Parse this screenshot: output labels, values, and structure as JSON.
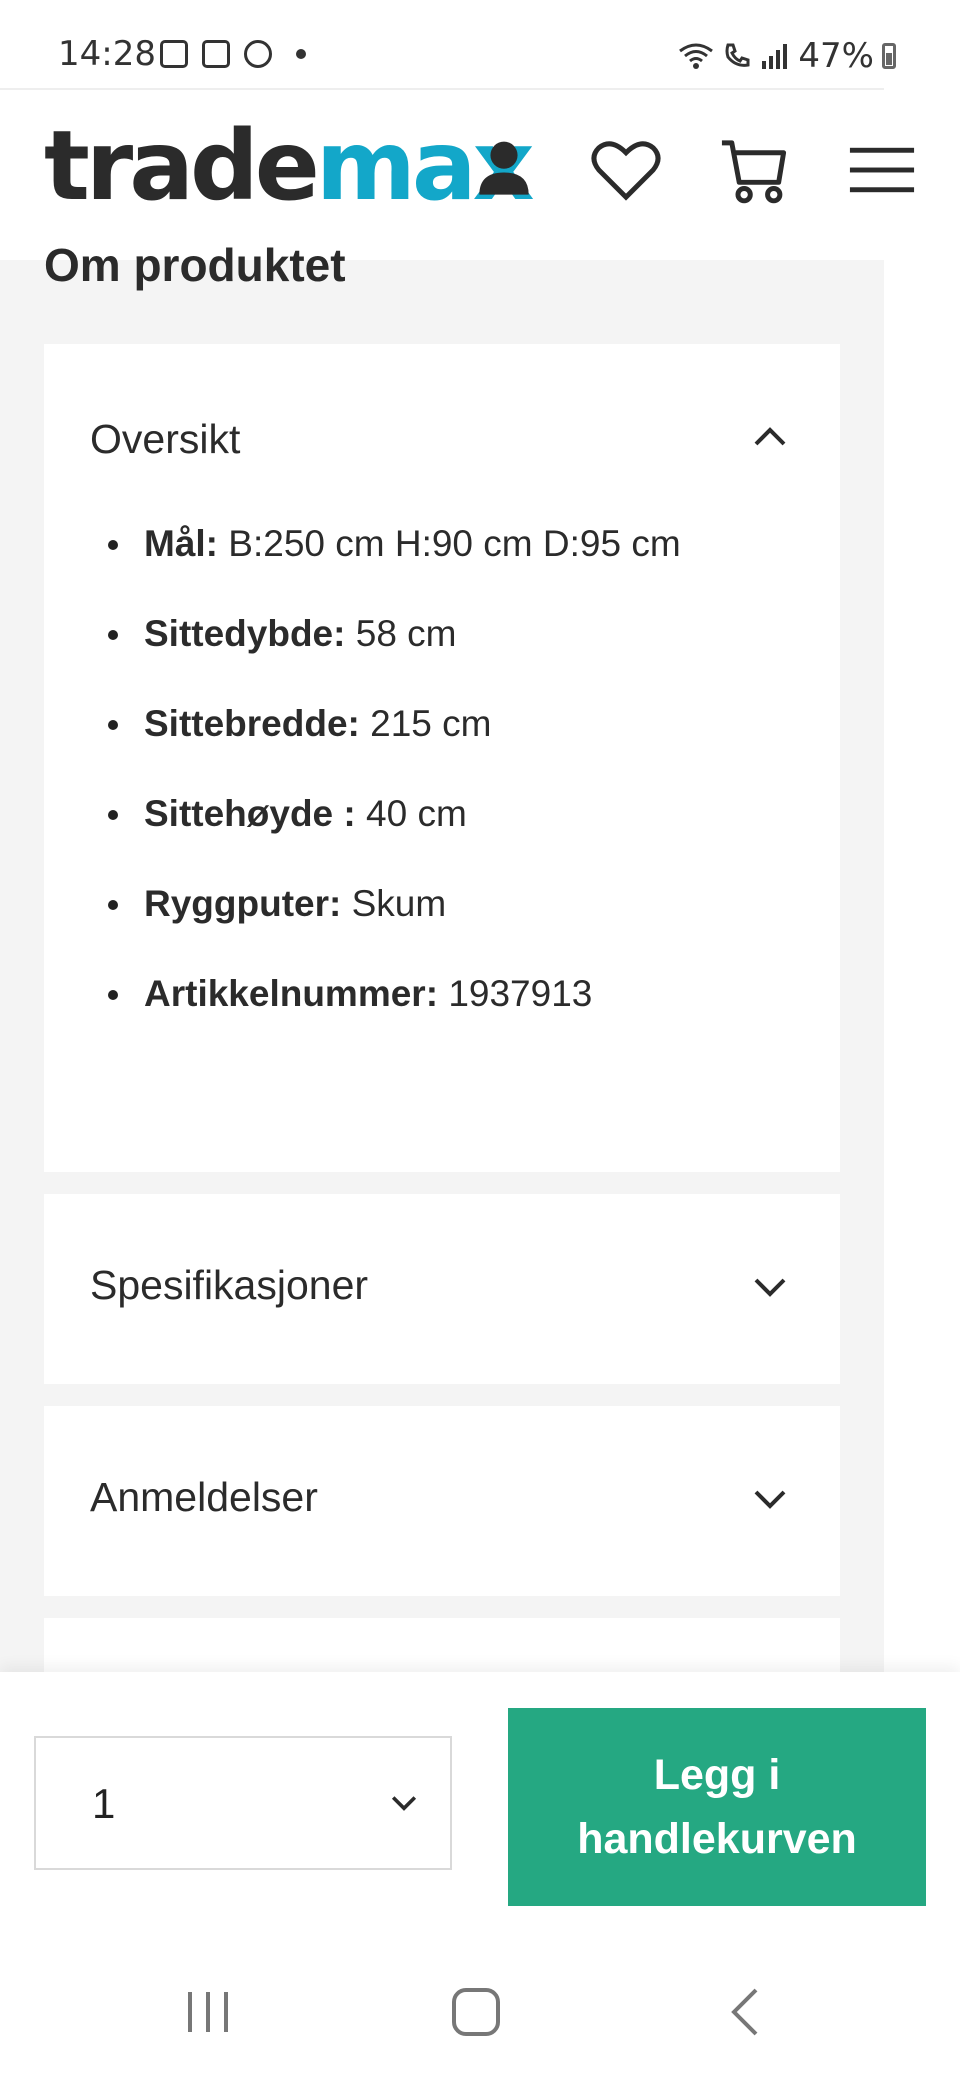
{
  "status_bar": {
    "time": "14:28",
    "battery": "47%",
    "icons": [
      "image-icon",
      "calendar-icon",
      "chrome-icon",
      "dot-icon",
      "wifi-calling-icon",
      "call-icon",
      "signal-icon",
      "battery-icon"
    ]
  },
  "header": {
    "logo_part1": "trade",
    "logo_part2": "max",
    "logo_colors": {
      "part1": "#2b2b2b",
      "part2": "#13a7c9"
    },
    "icons": [
      "account-icon",
      "heart-icon",
      "cart-icon",
      "menu-icon"
    ]
  },
  "section": {
    "title": "Om produktet"
  },
  "overview": {
    "title": "Oversikt",
    "expanded": true,
    "items": [
      {
        "key": "Mål:",
        "value": "B:250 cm H:90 cm D:95 cm"
      },
      {
        "key": "Sittedybde:",
        "value": "58 cm"
      },
      {
        "key": "Sittebredde:",
        "value": "215 cm"
      },
      {
        "key": "Sittehøyde :",
        "value": "40 cm"
      },
      {
        "key": "Ryggputer:",
        "value": "Skum"
      },
      {
        "key": "Artikkelnummer:",
        "value": "1937913"
      }
    ]
  },
  "accordions": [
    {
      "title": "Spesifikasjoner",
      "expanded": false
    },
    {
      "title": "Anmeldelser",
      "expanded": false
    }
  ],
  "purchase": {
    "quantity": "1",
    "add_button": "Legg i handlekurven",
    "button_color": "#25a882"
  },
  "nav_bar": {
    "icons": [
      "recent-apps-icon",
      "home-icon",
      "back-icon"
    ]
  }
}
